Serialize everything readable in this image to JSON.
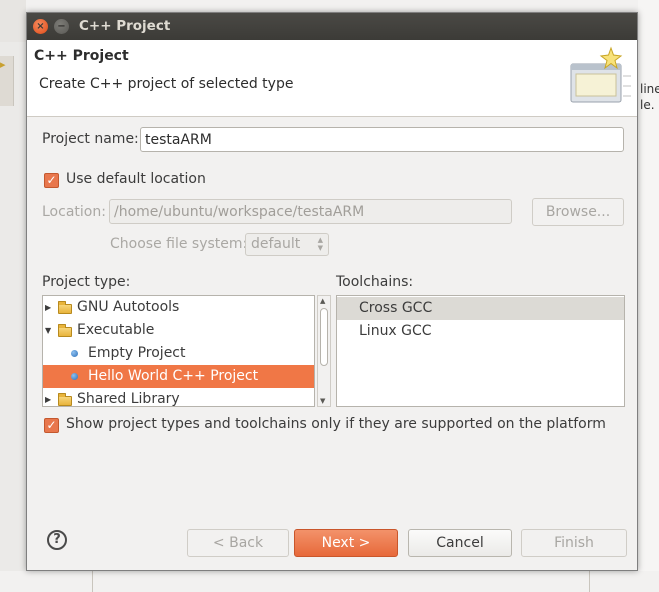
{
  "window": {
    "title": "C++ Project",
    "close_glyph": "×",
    "minimize_glyph": "−"
  },
  "header": {
    "title": "C++ Project",
    "description": "Create C++ project of selected type",
    "icon": "new-project-wizard-icon"
  },
  "form": {
    "project_name_label": "Project name:",
    "project_name_value": "testaARM",
    "use_default_location_label": "Use default location",
    "use_default_location_checked": true,
    "location_label": "Location:",
    "location_value": "/home/ubuntu/workspace/testaARM",
    "browse_label": "Browse...",
    "file_system_label": "Choose file system:",
    "file_system_value": "default"
  },
  "project_type": {
    "label": "Project type:",
    "items": [
      {
        "label": "GNU Autotools",
        "kind": "folder",
        "expander": "collapsed"
      },
      {
        "label": "Executable",
        "kind": "folder",
        "expander": "expanded"
      },
      {
        "label": "Empty Project",
        "kind": "project",
        "expander": "none"
      },
      {
        "label": "Hello World C++ Project",
        "kind": "project",
        "expander": "none",
        "selected": true
      },
      {
        "label": "Shared Library",
        "kind": "folder",
        "expander": "collapsed"
      }
    ]
  },
  "toolchains": {
    "label": "Toolchains:",
    "items": [
      {
        "label": "Cross GCC",
        "selected": true
      },
      {
        "label": "Linux GCC",
        "selected": false
      }
    ]
  },
  "filter": {
    "label": "Show project types and toolchains only if they are supported on the platform",
    "checked": true
  },
  "buttons": {
    "help_glyph": "?",
    "back": "< Back",
    "next": "Next >",
    "cancel": "Cancel",
    "finish": "Finish"
  },
  "background": {
    "right_fragments": [
      "line",
      "le."
    ]
  },
  "colors": {
    "accent": "#f07746",
    "titlebar": "#3c3b37",
    "checkbox": "#e8774d"
  }
}
